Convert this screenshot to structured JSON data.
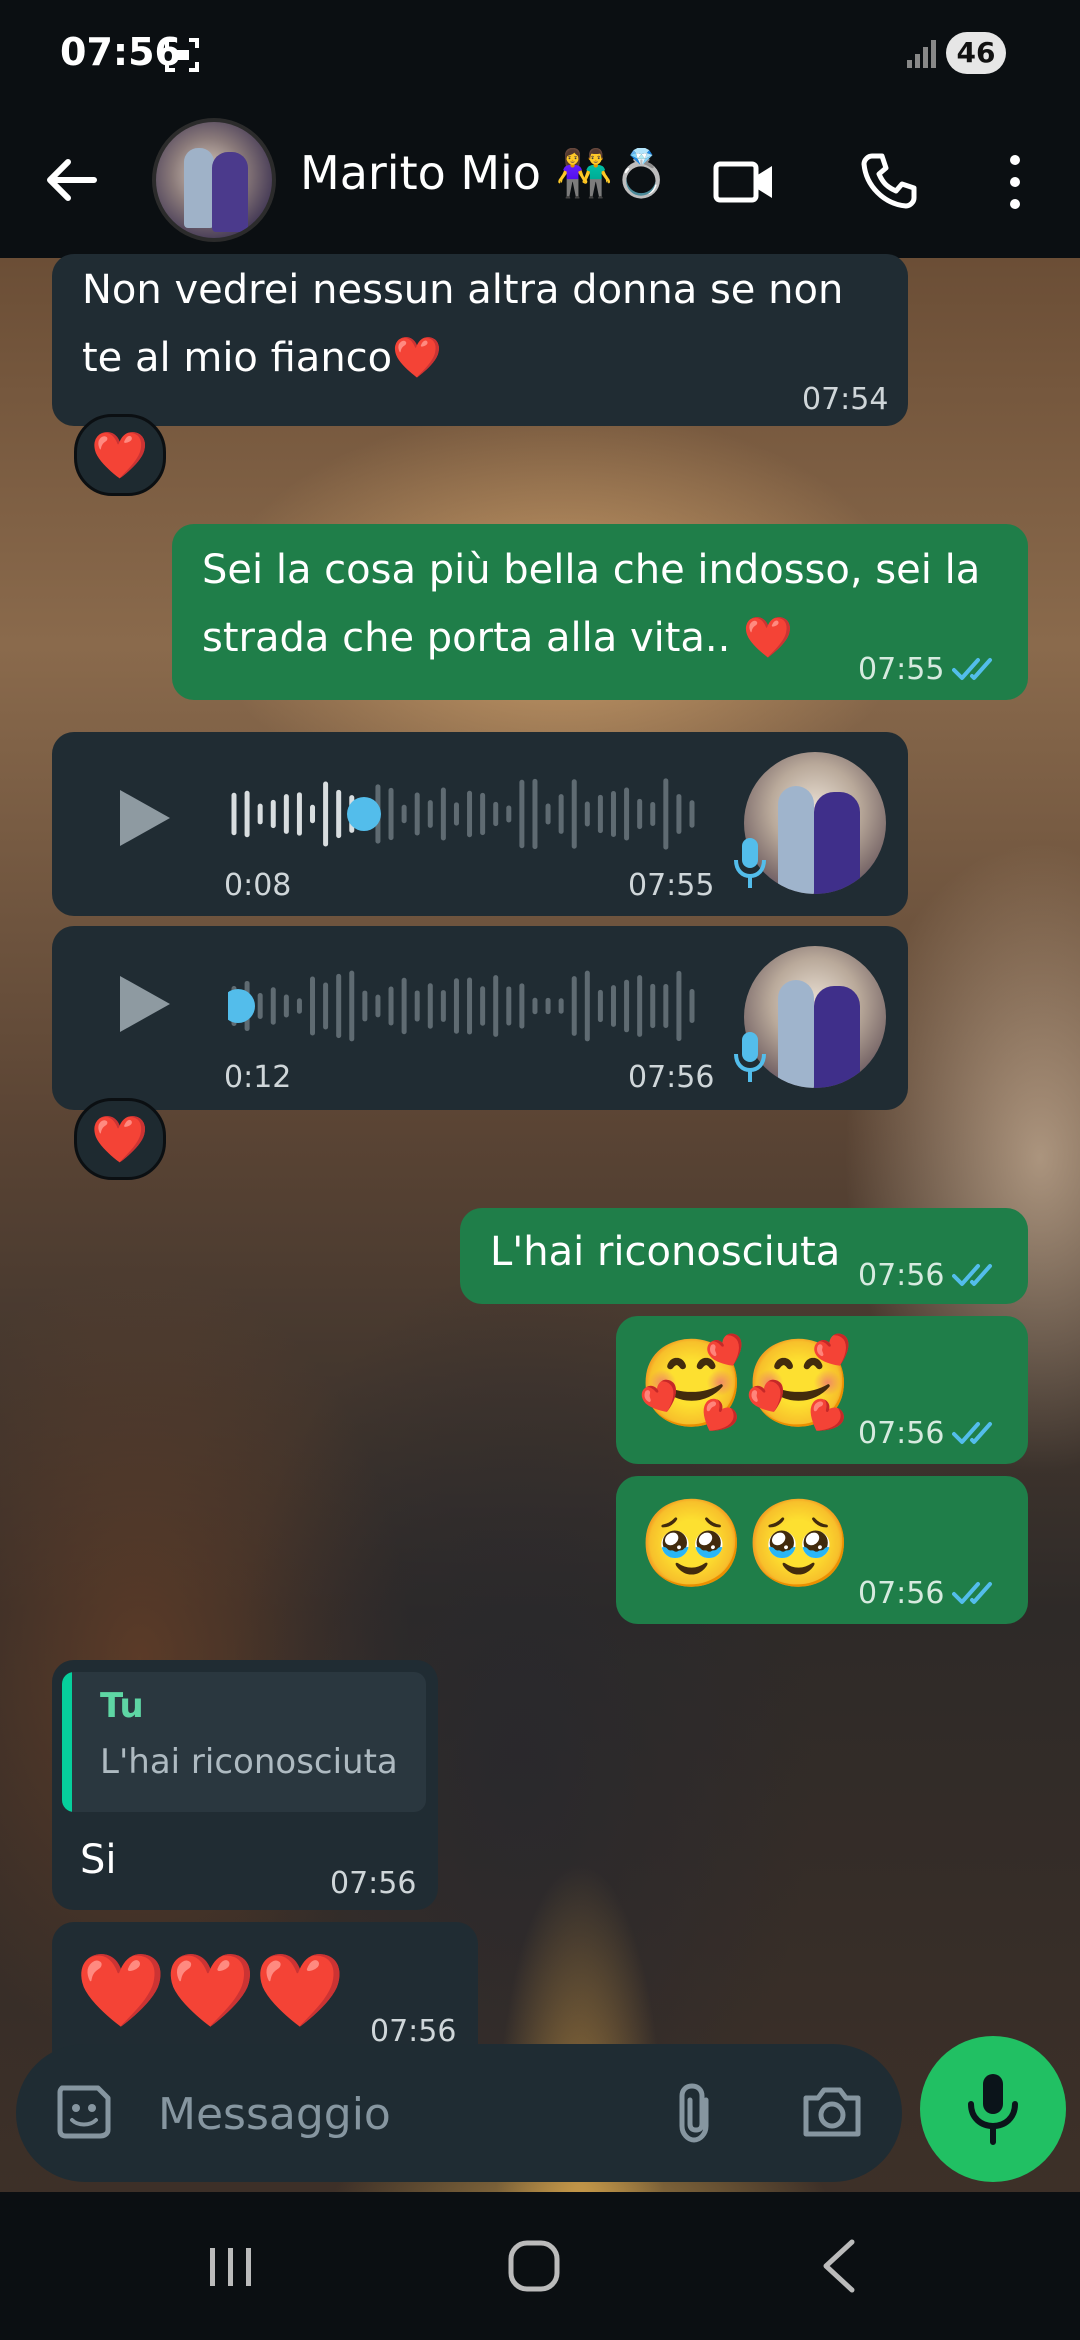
{
  "status_bar": {
    "time": "07:56",
    "battery": "46"
  },
  "header": {
    "contact_name": "Marito Mio 👫💍"
  },
  "messages": [
    {
      "type": "text",
      "dir": "in",
      "lines": [
        "Non vedrei nessun altra donna se non",
        "te al mio fianco❤️"
      ],
      "time": "07:54",
      "reaction": "❤️"
    },
    {
      "type": "text",
      "dir": "out",
      "lines": [
        "Sei la cosa più bella che indosso, sei la",
        "strada che porta alla vita.. ❤️"
      ],
      "time": "07:55"
    },
    {
      "type": "voice",
      "dir": "in",
      "duration": "0:08",
      "time": "07:55",
      "progress": 0.28
    },
    {
      "type": "voice",
      "dir": "in",
      "duration": "0:12",
      "time": "07:56",
      "progress": 0.0,
      "reaction": "❤️"
    },
    {
      "type": "text",
      "dir": "out",
      "text": "L'hai riconosciuta",
      "time": "07:56"
    },
    {
      "type": "emoji",
      "dir": "out",
      "text": "🥰🥰",
      "time": "07:56"
    },
    {
      "type": "emoji",
      "dir": "out",
      "text": "🥹🥹",
      "time": "07:56"
    },
    {
      "type": "reply",
      "dir": "in",
      "quote_author": "Tu",
      "quote_text": "L'hai riconosciuta",
      "text": "Si",
      "time": "07:56"
    },
    {
      "type": "emoji",
      "dir": "in",
      "text": "❤️❤️❤️",
      "time": "07:56"
    }
  ],
  "input": {
    "placeholder": "Messaggio",
    "value": ""
  },
  "colors": {
    "outgoing_bubble": "#1f7e49",
    "incoming_bubble": "#202c33",
    "accent": "#21c063",
    "read_ticks": "#53bdeb"
  }
}
